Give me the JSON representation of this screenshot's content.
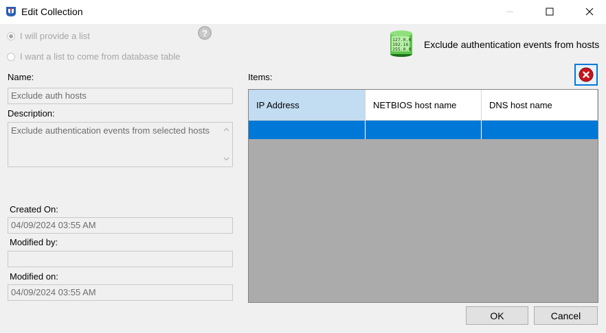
{
  "window": {
    "title": "Edit Collection"
  },
  "source": {
    "option_provide": "I will provide a list",
    "option_database": "I want a list to come from database table",
    "selected": "provide"
  },
  "header": {
    "description": "Exclude authentication events from hosts",
    "icon": "database-icon"
  },
  "form": {
    "name_label": "Name:",
    "name_value": "Exclude auth hosts",
    "description_label": "Description:",
    "description_value": "Exclude authentication events from selected hosts",
    "created_on_label": "Created On:",
    "created_on_value": "04/09/2024 03:55 AM",
    "modified_by_label": "Modified by:",
    "modified_by_value": "",
    "modified_on_label": "Modified on:",
    "modified_on_value": "04/09/2024 03:55 AM"
  },
  "items": {
    "label": "Items:",
    "columns": [
      "IP Address",
      "NETBIOS host name",
      "DNS host name"
    ],
    "rows": [
      [
        "",
        "",
        ""
      ]
    ]
  },
  "buttons": {
    "ok": "OK",
    "cancel": "Cancel"
  }
}
